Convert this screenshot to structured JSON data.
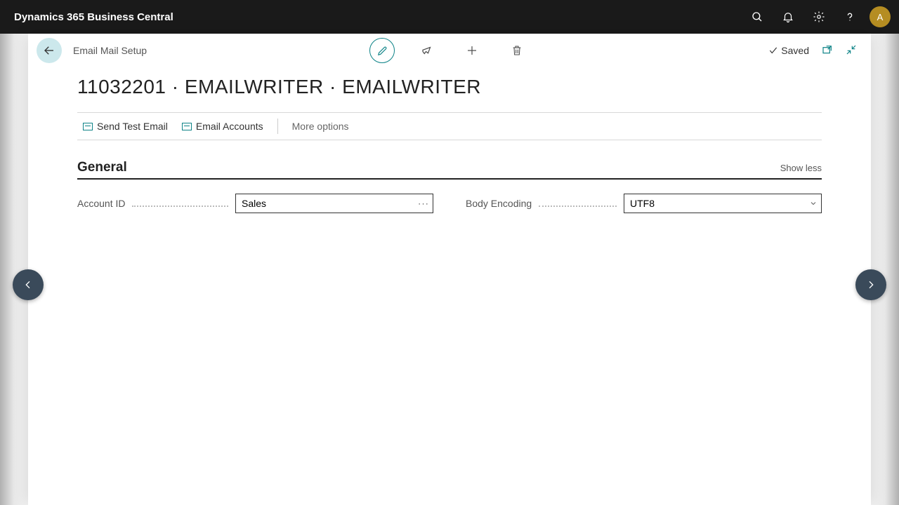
{
  "topbar": {
    "app_title": "Dynamics 365 Business Central",
    "avatar_initial": "A"
  },
  "page": {
    "breadcrumb": "Email Mail Setup",
    "title": "11032201 · EMAILWRITER · EMAILWRITER",
    "saved_label": "Saved"
  },
  "actions": {
    "send_test": "Send Test Email",
    "email_accounts": "Email Accounts",
    "more_options": "More options"
  },
  "section": {
    "title": "General",
    "show_less": "Show less"
  },
  "fields": {
    "account_id": {
      "label": "Account ID",
      "value": "Sales"
    },
    "body_encoding": {
      "label": "Body Encoding",
      "value": "UTF8"
    }
  }
}
